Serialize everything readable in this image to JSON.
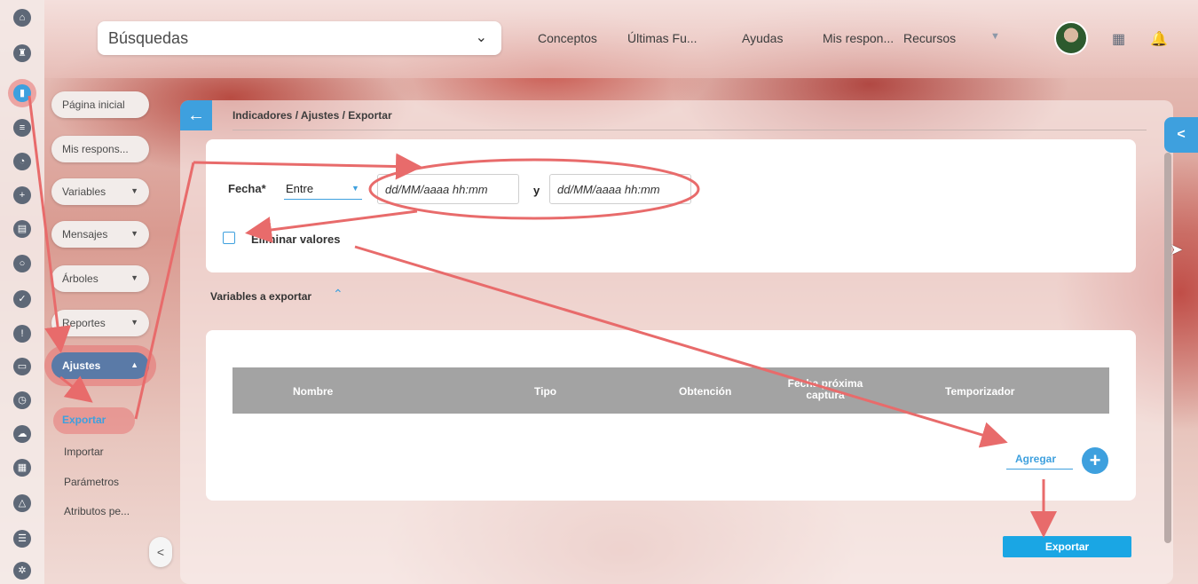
{
  "topbar": {
    "search_label": "Búsquedas",
    "nav": [
      "Conceptos",
      "Últimas Fu...",
      "Ayudas",
      "Mis respon...",
      "Recursos"
    ]
  },
  "rail_icons": [
    "home-icon",
    "chess-icon",
    "chart-icon",
    "equals-icon",
    "pie-icon",
    "plus-box-icon",
    "book-icon",
    "circle-icon",
    "check-icon",
    "warning-icon",
    "monitor-icon",
    "clock-icon",
    "cloud-icon",
    "calendar-icon",
    "network-icon",
    "list-icon",
    "gear-icon"
  ],
  "sidemenu": {
    "pagina_inicial": "Página inicial",
    "mis_respons": "Mis respons...",
    "variables": "Variables",
    "mensajes": "Mensajes",
    "arboles": "Árboles",
    "reportes": "Reportes",
    "ajustes": "Ajustes",
    "sub": {
      "exportar": "Exportar",
      "importar": "Importar",
      "parametros": "Parámetros",
      "atributos": "Atributos pe..."
    }
  },
  "breadcrumb": "Indicadores / Ajustes / Exportar",
  "form": {
    "fecha_label": "Fecha*",
    "operator": "Entre",
    "date_placeholder": "dd/MM/aaaa hh:mm",
    "y_label": "y",
    "eliminar_label": "Eliminar valores"
  },
  "section": {
    "title": "Variables a exportar"
  },
  "table": {
    "headers": [
      "Nombre",
      "Tipo",
      "Obtención",
      "Fecha próxima captura",
      "Temporizador"
    ]
  },
  "actions": {
    "agregar": "Agregar",
    "exportar": "Exportar"
  },
  "colors": {
    "accent": "#3ea0de",
    "annotation": "#e86b6b",
    "header": "#a3a3a3"
  }
}
